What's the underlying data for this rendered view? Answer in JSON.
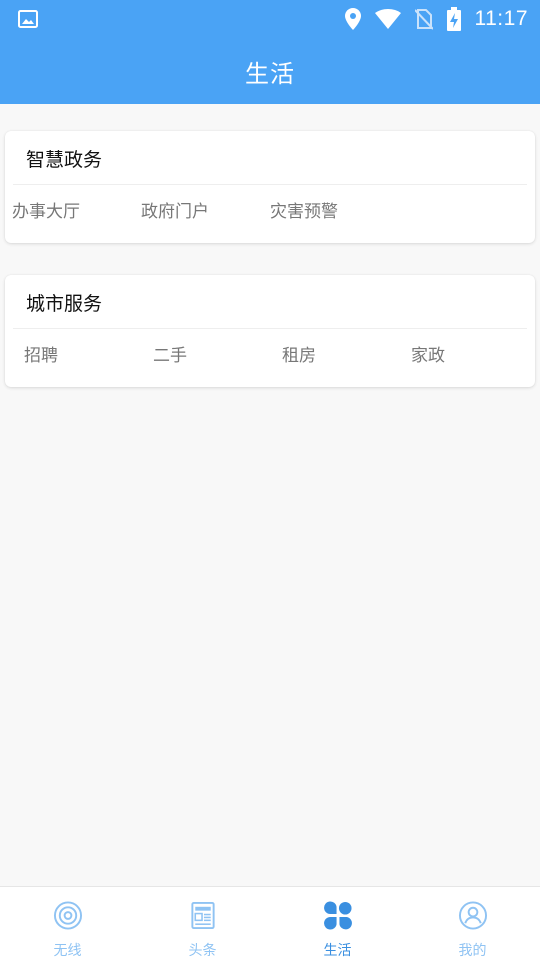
{
  "status_bar": {
    "time": "11:17",
    "icons": [
      "image-icon",
      "location-icon",
      "wifi-icon",
      "no-sim-icon",
      "battery-charging-icon"
    ]
  },
  "app_bar": {
    "title": "生活"
  },
  "sections": {
    "gov": {
      "title": "智慧政务",
      "items": [
        "办事大厅",
        "政府门户",
        "灾害预警"
      ]
    },
    "city": {
      "title": "城市服务",
      "items": [
        "招聘",
        "二手",
        "租房",
        "家政"
      ]
    }
  },
  "bottom_nav": {
    "active_color": "#3a8fe0",
    "inactive_color": "#8fc3f3",
    "items": [
      {
        "label": "无线",
        "icon": "radar-icon",
        "active": false
      },
      {
        "label": "头条",
        "icon": "news-icon",
        "active": false
      },
      {
        "label": "生活",
        "icon": "grid-petals-icon",
        "active": true
      },
      {
        "label": "我的",
        "icon": "profile-icon",
        "active": false
      }
    ]
  },
  "colors": {
    "primary": "#4aa3f5",
    "background": "#f8f8f8",
    "card": "#ffffff"
  }
}
